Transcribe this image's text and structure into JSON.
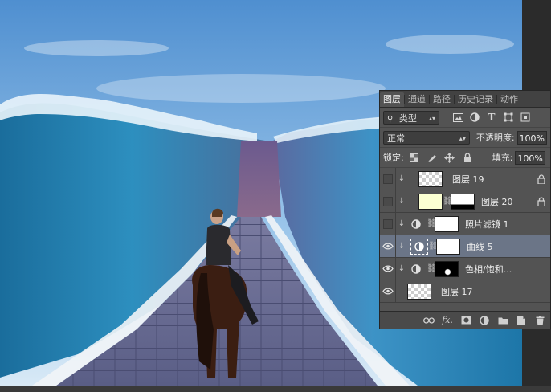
{
  "panel": {
    "tabs": [
      {
        "label": "图层",
        "active": true
      },
      {
        "label": "通道",
        "active": false
      },
      {
        "label": "路径",
        "active": false
      },
      {
        "label": "历史记录",
        "active": false
      },
      {
        "label": "动作",
        "active": false
      }
    ],
    "filter": {
      "kind_label": "类型",
      "search_icon": "search-icon"
    },
    "blend_mode": "正常",
    "opacity_label": "不透明度:",
    "opacity_value": "100%",
    "lock_label": "锁定:",
    "fill_label": "填充:",
    "fill_value": "100%",
    "layers": [
      {
        "name": "图层 19",
        "visible": false,
        "clipped": true,
        "thumb": "checker",
        "locked": true
      },
      {
        "name": "图层 20",
        "visible": false,
        "clipped": true,
        "thumb": "yellow",
        "mask": "white-black-bottom",
        "locked": true
      },
      {
        "name": "照片滤镜 1",
        "visible": false,
        "clipped": true,
        "adjustment": true,
        "mask": "white"
      },
      {
        "name": "曲线 5",
        "visible": true,
        "clipped": true,
        "adjustment": true,
        "mask": "white",
        "selected": true
      },
      {
        "name": "色相/饱和...",
        "visible": true,
        "clipped": true,
        "adjustment": true,
        "mask": "black-white-spot"
      },
      {
        "name": "图层 17",
        "visible": true,
        "clipped": false,
        "thumb": "checker"
      }
    ],
    "colors": {
      "panel_bg": "#535353",
      "selected_row": "#6b7587",
      "tab_bar": "#424242"
    }
  }
}
